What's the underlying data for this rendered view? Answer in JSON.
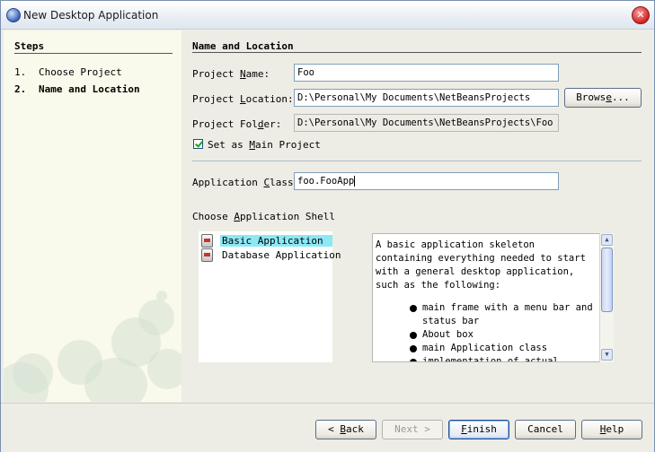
{
  "window": {
    "title": "New Desktop Application"
  },
  "steps": {
    "title": "Steps",
    "items": [
      {
        "num": "1.",
        "label": "Choose Project"
      },
      {
        "num": "2.",
        "label": "Name and Location"
      }
    ]
  },
  "section": {
    "title": "Name and Location"
  },
  "form": {
    "project_name_label_pre": "Project ",
    "project_name_label_key": "N",
    "project_name_label_post": "ame:",
    "project_name": "Foo",
    "project_location_label_pre": "Project ",
    "project_location_label_key": "L",
    "project_location_label_post": "ocation:",
    "project_location": "D:\\Personal\\My Documents\\NetBeansProjects",
    "browse_pre": "Brows",
    "browse_key": "e",
    "browse_post": "...",
    "project_folder_label_pre": "Project Fol",
    "project_folder_label_key": "d",
    "project_folder_label_post": "er:",
    "project_folder": "D:\\Personal\\My Documents\\NetBeansProjects\\Foo",
    "main_project_pre": "Set as ",
    "main_project_key": "M",
    "main_project_post": "ain Project",
    "main_project_checked": true,
    "app_class_label_pre": "Application ",
    "app_class_label_key": "C",
    "app_class_label_post": "lass:",
    "app_class": "foo.FooApp"
  },
  "shell": {
    "label_pre": "Choose ",
    "label_key": "A",
    "label_post": "pplication Shell",
    "items": [
      {
        "label": "Basic Application",
        "selected": true
      },
      {
        "label": "Database Application",
        "selected": false
      }
    ],
    "description": "A basic application skeleton containing everything needed to start with a general desktop application, such as the following:",
    "bullets": [
      "main frame with a menu bar and status bar",
      "About box",
      "main Application class",
      "implementation of actual..."
    ]
  },
  "footer": {
    "back_pre": "< ",
    "back_key": "B",
    "back_post": "ack",
    "next": "Next >",
    "finish_key": "F",
    "finish_post": "inish",
    "cancel": "Cancel",
    "help_key": "H",
    "help_post": "elp"
  }
}
